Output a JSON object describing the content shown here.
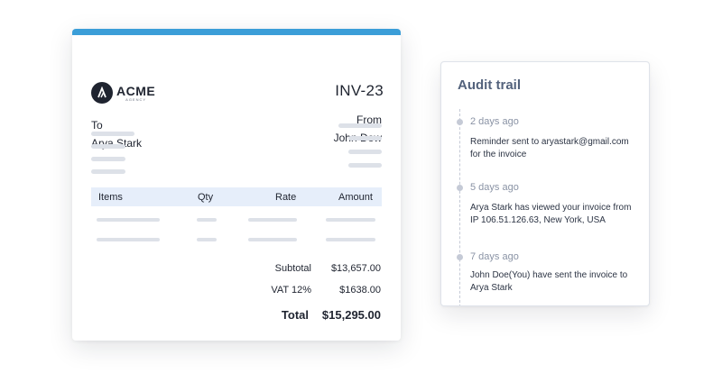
{
  "invoice": {
    "logo": {
      "word": "ACME",
      "sub": "AGENCY"
    },
    "number": "INV-23",
    "to_label": "To",
    "to_name": "Arya Stark",
    "from_label": "From",
    "from_name": "John Dow",
    "table": {
      "headers": [
        "Items",
        "Qty",
        "Rate",
        "Amount"
      ]
    },
    "summary": {
      "subtotal_label": "Subtotal",
      "subtotal_value": "$13,657.00",
      "vat_label": "VAT 12%",
      "vat_value": "$1638.00",
      "total_label": "Total",
      "total_value": "$15,295.00"
    },
    "accent_color": "#3b9ed8",
    "header_bg_color": "#e6eefa"
  },
  "audit": {
    "title": "Audit trail",
    "events": [
      {
        "time": "2 days ago",
        "text": "Reminder sent to aryastark@gmail.com for the invoice"
      },
      {
        "time": "5 days ago",
        "text": "Arya Stark has viewed your invoice from IP 106.51.126.63, New York, USA"
      },
      {
        "time": "7 days ago",
        "text": "John Doe(You) have sent the invoice to Arya Stark"
      }
    ],
    "title_color": "#53627c"
  }
}
